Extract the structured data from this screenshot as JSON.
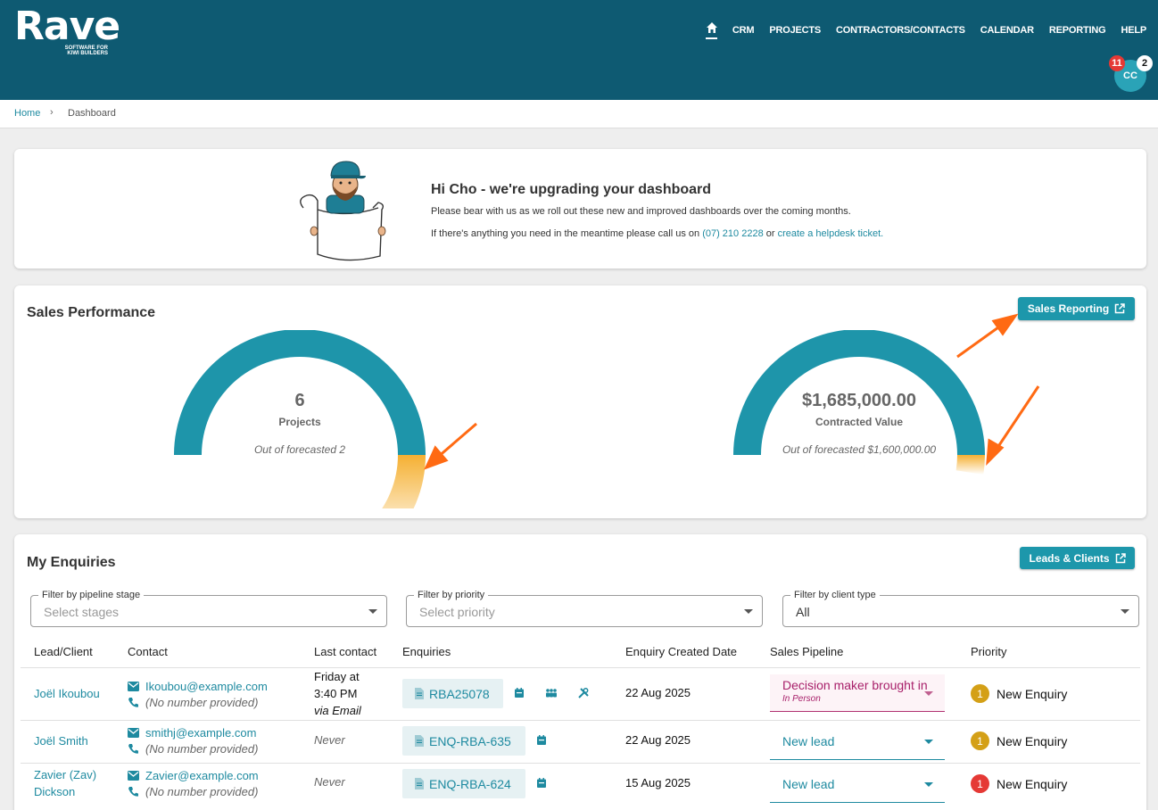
{
  "header": {
    "logo_word": "Rave",
    "logo_tagline_1": "SOFTWARE FOR",
    "logo_tagline_2": "KIWI BUILDERS",
    "nav": [
      "CRM",
      "PROJECTS",
      "CONTRACTORS/CONTACTS",
      "CALENDAR",
      "REPORTING",
      "HELP"
    ],
    "avatar_initials": "CC",
    "notifications_count": "11",
    "messages_count": "2"
  },
  "breadcrumb": {
    "home": "Home",
    "separator": "›",
    "current": "Dashboard"
  },
  "banner": {
    "title": "Hi Cho - we're upgrading your dashboard",
    "line1": "Please bear with us as we roll out these new and improved dashboards over the coming months.",
    "line2_prefix": "If there's anything you need in the meantime please call us on",
    "phone": "(07) 210 2228",
    "line2_mid": "or",
    "helpdesk_link": "create a helpdesk ticket."
  },
  "sales": {
    "title": "Sales Performance",
    "button": "Sales Reporting",
    "gauges": [
      {
        "value": "6",
        "label": "Projects",
        "forecast": "Out of forecasted 2",
        "fill_fraction": 1.0,
        "overflow_fraction": 0.25
      },
      {
        "value": "$1,685,000.00",
        "label": "Contracted Value",
        "forecast": "Out of forecasted $1,600,000.00",
        "fill_fraction": 1.0,
        "overflow_fraction": 0.05
      }
    ]
  },
  "enquiries": {
    "title": "My Enquiries",
    "button": "Leads & Clients",
    "filters": [
      {
        "label": "Filter by pipeline stage",
        "placeholder": "Select stages",
        "value": ""
      },
      {
        "label": "Filter by priority",
        "placeholder": "Select priority",
        "value": ""
      },
      {
        "label": "Filter by client type",
        "placeholder": "",
        "value": "All"
      }
    ],
    "columns": [
      "Lead/Client",
      "Contact",
      "Last contact",
      "Enquiries",
      "Enquiry Created Date",
      "Sales Pipeline",
      "Priority"
    ],
    "rows": [
      {
        "client": "Joël Ikoubou",
        "email": "Ikoubou@example.com",
        "phone": "(No number provided)",
        "last_contact_1": "Friday at",
        "last_contact_2": "3:40 PM",
        "last_contact_3": "via Email",
        "enquiry": "RBA25078",
        "created": "22 Aug 2025",
        "pipeline": "Decision maker brought in",
        "pipeline_sub": "In Person",
        "priority_num": "1",
        "priority_label": "New Enquiry",
        "priority_color": "#d4a017"
      },
      {
        "client": "Joël Smith",
        "email": "smithj@example.com",
        "phone": "(No number provided)",
        "last_contact": "Never",
        "enquiry": "ENQ-RBA-635",
        "created": "22 Aug 2025",
        "pipeline": "New lead",
        "priority_num": "1",
        "priority_label": "New Enquiry",
        "priority_color": "#d4a017"
      },
      {
        "client_1": "Zavier (Zav)",
        "client_2": "Dickson",
        "email": "Zavier@example.com",
        "phone": "(No number provided)",
        "last_contact": "Never",
        "enquiry": "ENQ-RBA-624",
        "created": "15 Aug 2025",
        "pipeline": "New lead",
        "priority_num": "1",
        "priority_label": "New Enquiry",
        "priority_color": "#e53935"
      }
    ]
  },
  "colors": {
    "header_bg": "#0e5a72",
    "accent": "#1d97ab",
    "gauge_fill": "#1e95aa",
    "gauge_overflow": "#f5b032",
    "arrow": "#ff6a13"
  }
}
